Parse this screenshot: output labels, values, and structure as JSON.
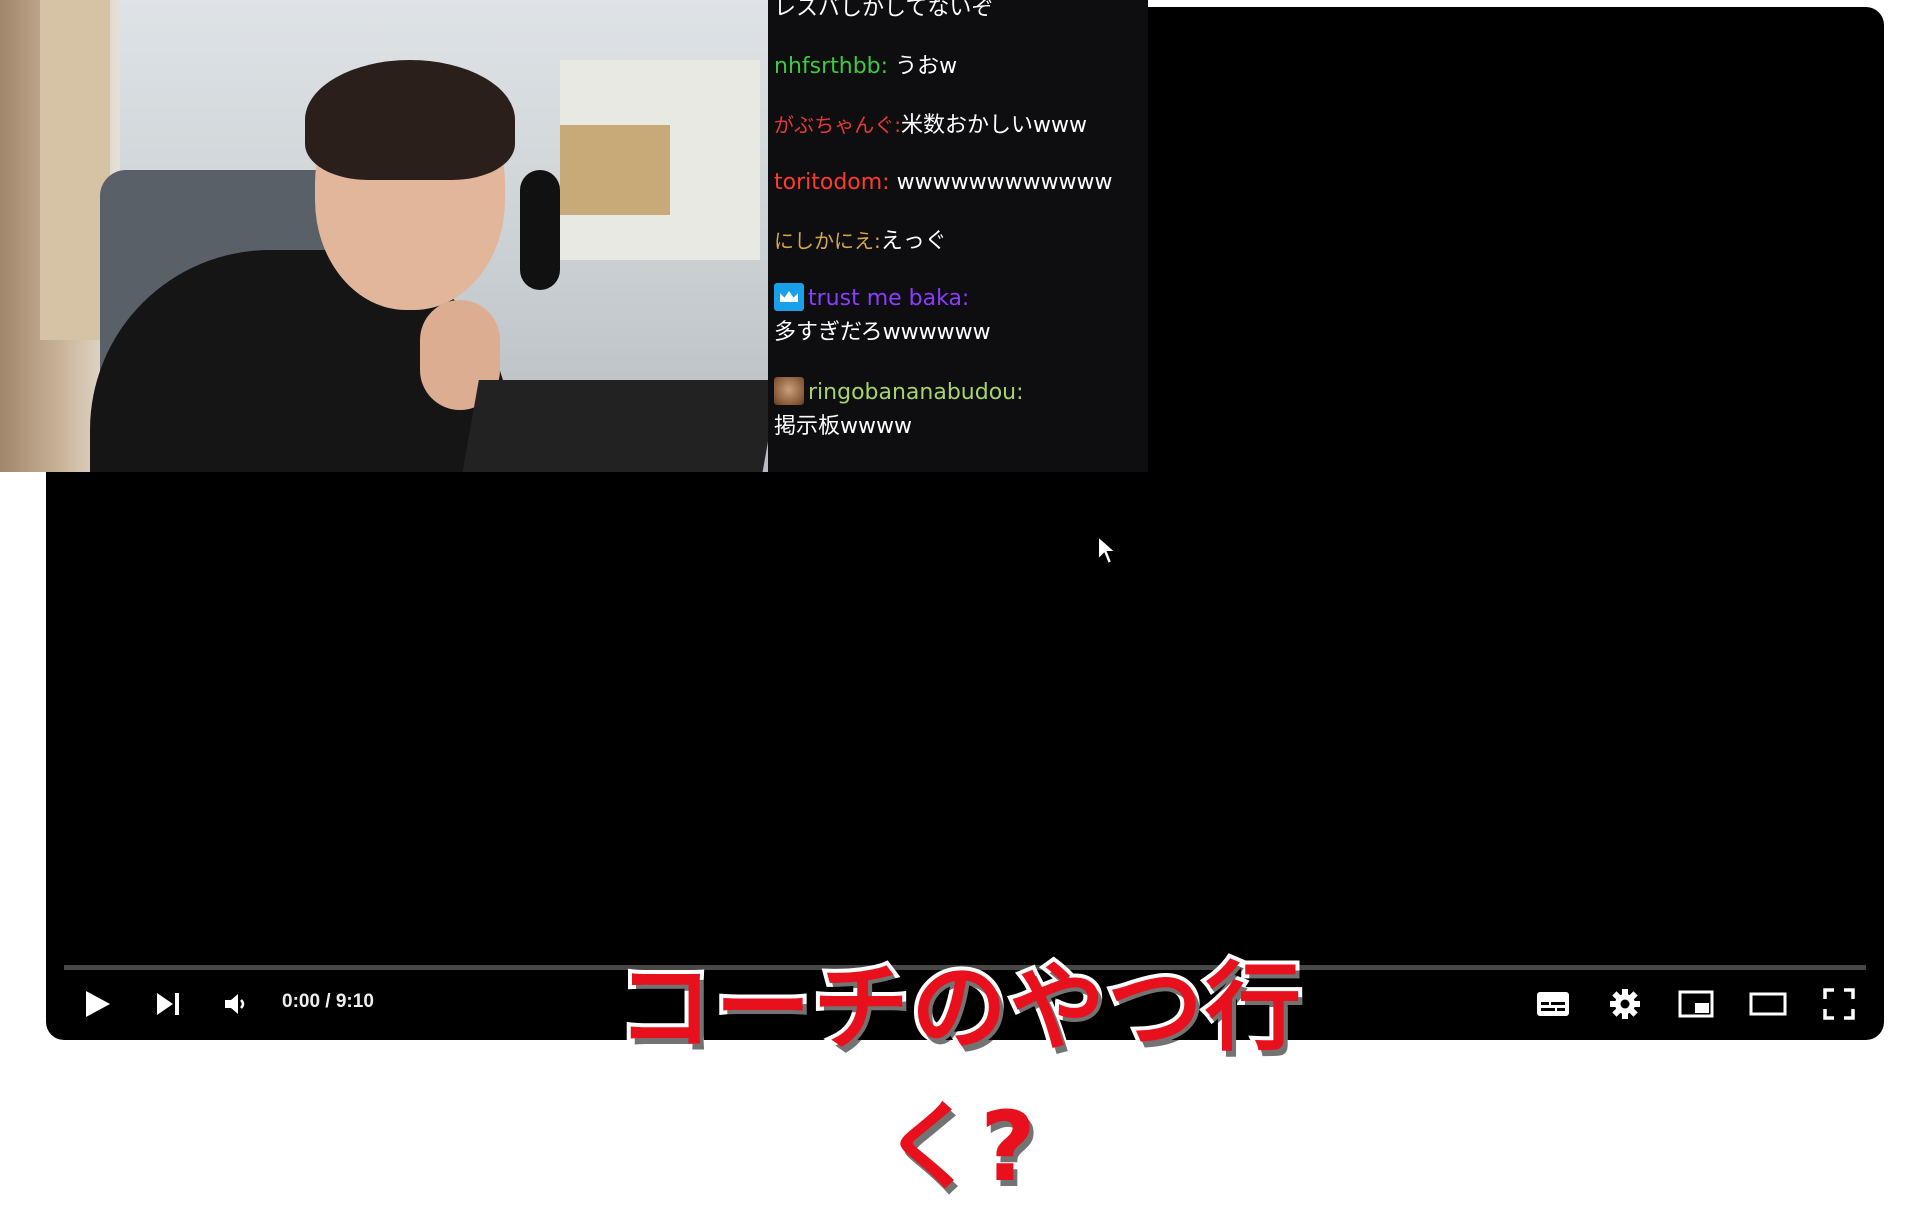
{
  "player": {
    "time_display": "0:00 / 9:10",
    "progress_fraction": 0
  },
  "chat": {
    "messages": [
      {
        "user": "",
        "text": "レスバしかしてないぞ",
        "user_color": "#ffffff",
        "badge": ""
      },
      {
        "user": "nhfsrthbb:",
        "text": "うおw",
        "user_color": "#3ec93e",
        "badge": ""
      },
      {
        "user": "がぶちゃんぐ:",
        "text": "米数おかしいwww",
        "user_color": "#e53935",
        "badge": ""
      },
      {
        "user": "toritodom:",
        "text": "wwwwwwwwwwww",
        "user_color": "#ff3a2f",
        "badge": ""
      },
      {
        "user": "にしかにえ:",
        "text": "えっぐ",
        "user_color": "#d9a64a",
        "badge": ""
      },
      {
        "user": "trust me baka:",
        "text": "多すぎだろwwwwww",
        "user_color": "#8a3cff",
        "badge": "crown-badge-icon"
      },
      {
        "user": "ringobananabudou:",
        "text": "掲示板wwww",
        "user_color": "#a6d36a",
        "badge": "dog-avatar-badge-icon"
      }
    ]
  },
  "caption": {
    "text": "コーチのやつ行く?"
  },
  "icons": {
    "play": "play-icon",
    "next": "next-icon",
    "volume": "volume-icon",
    "subtitles": "subtitles-icon",
    "settings": "gear-icon",
    "miniplayer": "miniplayer-icon",
    "theater": "theater-mode-icon",
    "fullscreen": "fullscreen-icon"
  }
}
